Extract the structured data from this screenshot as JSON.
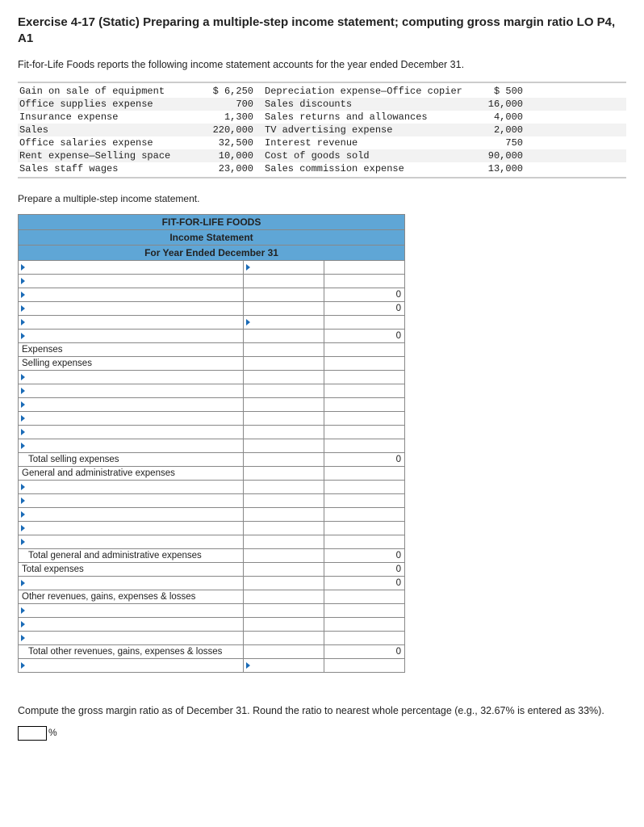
{
  "title": "Exercise 4-17 (Static) Preparing a multiple-step income statement; computing gross margin ratio LO P4, A1",
  "intro": "Fit-for-Life Foods reports the following income statement accounts for the year ended December 31.",
  "accounts": {
    "left": [
      {
        "name": "Gain on sale of equipment",
        "amt": "$  6,250"
      },
      {
        "name": "Office supplies expense",
        "amt": "700"
      },
      {
        "name": "Insurance expense",
        "amt": "1,300"
      },
      {
        "name": "Sales",
        "amt": "220,000"
      },
      {
        "name": "Office salaries expense",
        "amt": "32,500"
      },
      {
        "name": "Rent expense—Selling space",
        "amt": "10,000"
      },
      {
        "name": "Sales staff wages",
        "amt": "23,000"
      }
    ],
    "right": [
      {
        "name": "Depreciation expense—Office copier",
        "amt": "$    500"
      },
      {
        "name": "Sales discounts",
        "amt": "16,000"
      },
      {
        "name": "Sales returns and allowances",
        "amt": "4,000"
      },
      {
        "name": "TV advertising expense",
        "amt": "2,000"
      },
      {
        "name": "Interest revenue",
        "amt": "750"
      },
      {
        "name": "Cost of goods sold",
        "amt": "90,000"
      },
      {
        "name": "Sales commission expense",
        "amt": "13,000"
      }
    ]
  },
  "prepare": "Prepare a multiple-step income statement.",
  "worksheet": {
    "header1": "FIT-FOR-LIFE FOODS",
    "header2": "Income Statement",
    "header3": "For Year Ended December 31",
    "labels": {
      "expenses": "Expenses",
      "selling_expenses": "Selling expenses",
      "total_selling": "Total selling expenses",
      "ga_expenses": "General and administrative expenses",
      "total_ga": "Total general and administrative expenses",
      "total_exp": "Total expenses",
      "other": "Other revenues, gains, expenses & losses",
      "total_other": "Total other revenues, gains, expenses & losses"
    },
    "zero": "0"
  },
  "footer": "Compute the gross margin ratio as of December 31.  Round the ratio to nearest whole percentage (e.g., 32.67% is entered as 33%).",
  "pct": "%"
}
